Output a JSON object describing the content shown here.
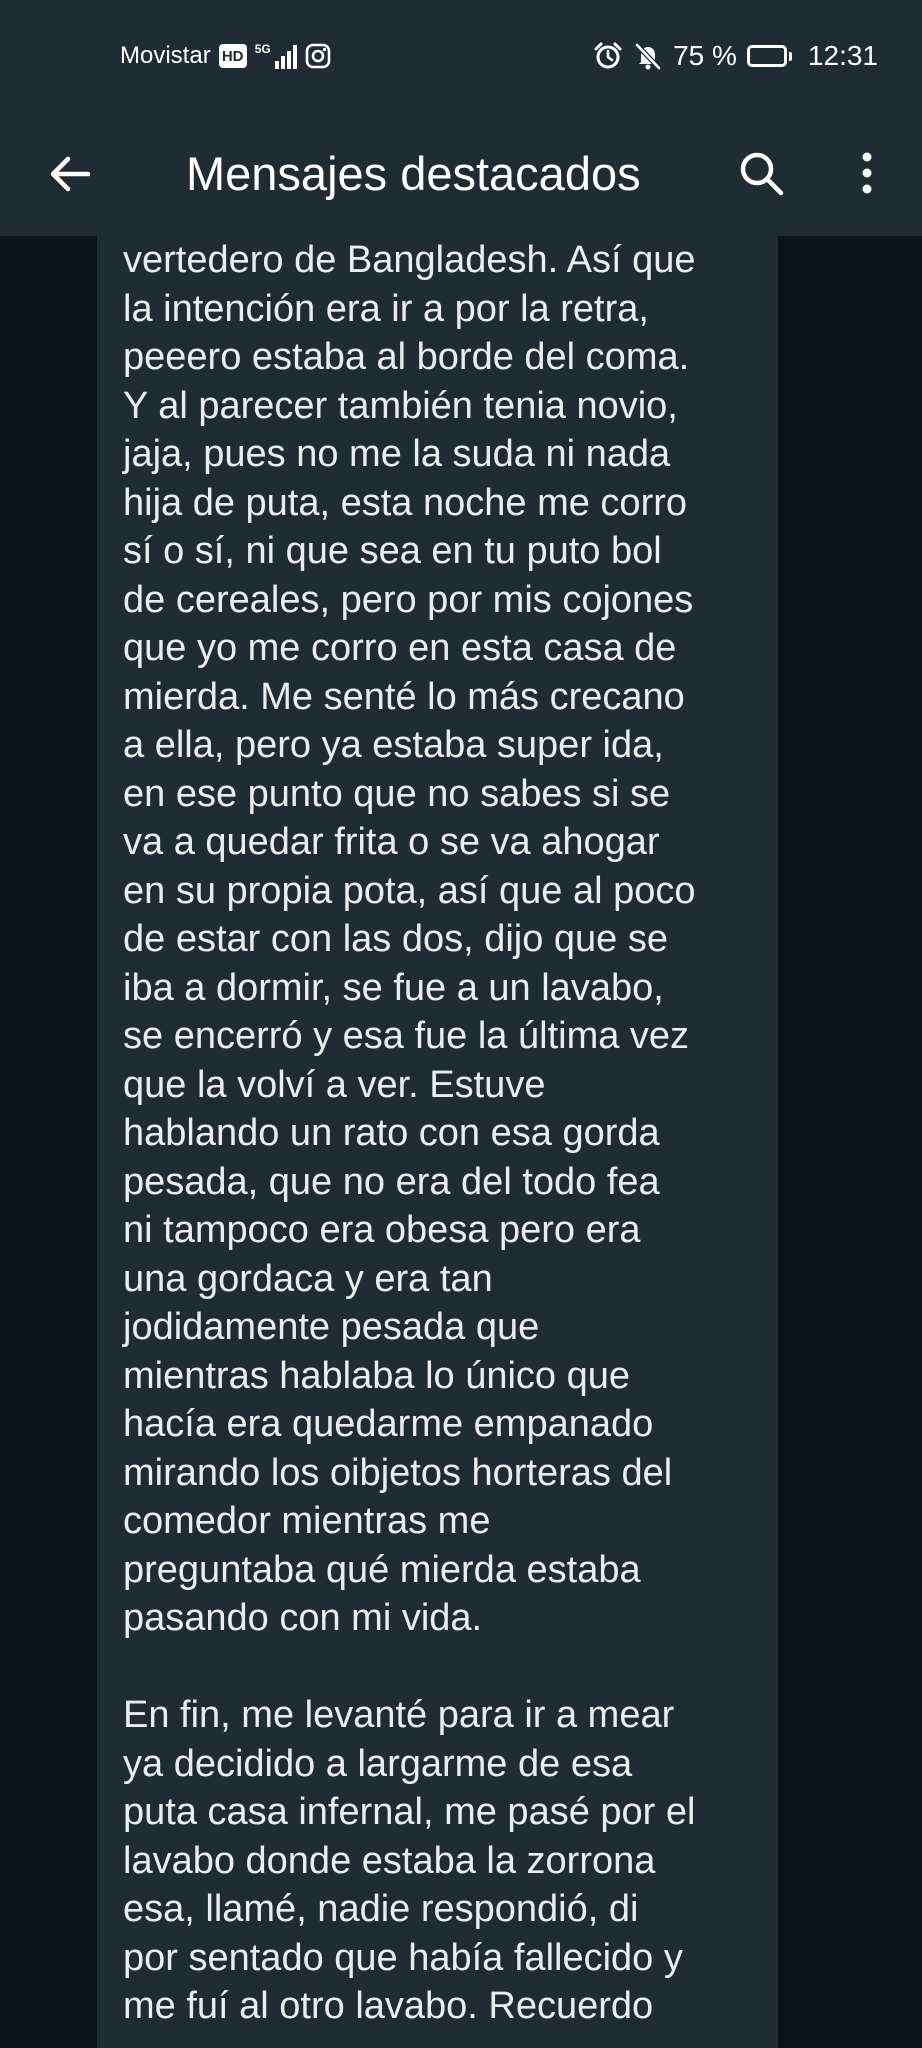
{
  "status_bar": {
    "carrier": "Movistar",
    "hd_badge": "HD",
    "network": "5G",
    "battery_percent": "75 %",
    "battery_level": 0.75,
    "time": "12:31"
  },
  "app_bar": {
    "title": "Mensajes destacados"
  },
  "message": {
    "paragraphs": [
      [
        "vertedero de Bangladesh. Así que",
        "la intención era ir a por la retra,",
        "peeero estaba al borde del coma.",
        "Y al parecer también tenia novio,",
        "jaja, pues no me la suda ni nada",
        "hija de puta, esta noche me corro",
        "sí o sí, ni que sea en tu puto bol",
        "de cereales, pero por mis cojones",
        "que yo me corro en esta casa de",
        "mierda. Me senté lo más crecano",
        "a ella, pero ya estaba super ida,",
        "en ese punto que no sabes si se",
        "va a quedar frita o se va ahogar",
        "en su propia pota, así que al poco",
        "de estar con las dos, dijo que se",
        "iba a dormir, se fue a un lavabo,",
        "se encerró y esa fue la última vez",
        "que la volví a ver. Estuve",
        "hablando un rato con esa gorda",
        "pesada, que no era del todo fea",
        "ni tampoco era obesa pero era",
        "una gordaca y era tan",
        "jodidamente pesada que",
        "mientras hablaba lo único que",
        "hacía era quedarme empanado",
        "mirando los oibjetos horteras del",
        "comedor mientras me",
        "preguntaba qué mierda estaba",
        "pasando con mi vida."
      ],
      [
        "En fin, me levanté para ir a mear",
        "ya decidido a largarme de esa",
        "puta casa infernal, me pasé por el",
        "lavabo donde estaba la zorrona",
        "esa, llamé, nadie respondió, di",
        "por sentado que había fallecido y",
        "me fuí al otro lavabo. Recuerdo"
      ]
    ]
  }
}
